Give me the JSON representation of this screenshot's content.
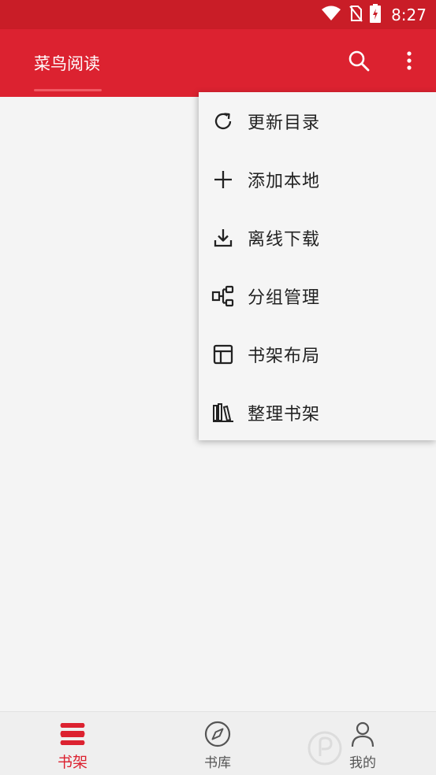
{
  "status_bar": {
    "time": "8:27",
    "icons": [
      "wifi-icon",
      "no-sim-icon",
      "battery-charging-icon"
    ]
  },
  "app_bar": {
    "tab_title": "菜鸟阅读",
    "icons": [
      "search-icon",
      "more-vert-icon"
    ]
  },
  "menu": {
    "items": [
      {
        "label": "更新目录",
        "icon": "refresh-icon"
      },
      {
        "label": "添加本地",
        "icon": "plus-icon"
      },
      {
        "label": "离线下载",
        "icon": "download-icon"
      },
      {
        "label": "分组管理",
        "icon": "group-icon"
      },
      {
        "label": "书架布局",
        "icon": "layout-icon"
      },
      {
        "label": "整理书架",
        "icon": "books-icon"
      }
    ]
  },
  "bottom_nav": {
    "items": [
      {
        "label": "书架",
        "icon": "bookshelf-icon",
        "active": true
      },
      {
        "label": "书库",
        "icon": "compass-icon",
        "active": false
      },
      {
        "label": "我的",
        "icon": "person-icon",
        "active": false
      }
    ]
  },
  "colors": {
    "status_bar": "#c91d27",
    "primary": "#dc2230",
    "background": "#f4f4f4"
  }
}
